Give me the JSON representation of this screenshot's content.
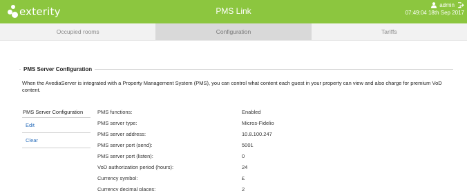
{
  "header": {
    "logo_text": "exterity",
    "app_title": "PMS Link",
    "user_name": "admin",
    "datetime": "07:49:04 18th Sep 2017",
    "icons": {
      "user": "user-icon",
      "logout": "logout-icon"
    }
  },
  "tabs": [
    {
      "label": "Occupied rooms",
      "active": false
    },
    {
      "label": "Configuration",
      "active": true
    },
    {
      "label": "Tariffs",
      "active": false
    }
  ],
  "section": {
    "title": "PMS Server Configuration",
    "intro": "When the AvediaServer is integrated with a Property Management System (PMS), you can control what content each guest in your property can view and also charge for premium VoD content."
  },
  "sidebar": {
    "title": "PMS Server Configuration",
    "items": [
      {
        "label": "Edit"
      },
      {
        "label": "Clear"
      }
    ]
  },
  "settings": [
    {
      "label": "PMS functions:",
      "value": "Enabled"
    },
    {
      "label": "PMS server type:",
      "value": "Micros-Fidelio"
    },
    {
      "label": "PMS server address:",
      "value": "10.8.100.247"
    },
    {
      "label": "PMS server port (send):",
      "value": "5001"
    },
    {
      "label": "PMS server port (listen):",
      "value": "0"
    },
    {
      "label": "VoD authorization period (hours):",
      "value": "24"
    },
    {
      "label": "Currency symbol:",
      "value": "£"
    },
    {
      "label": "Currency decimal places:",
      "value": "2"
    }
  ],
  "colors": {
    "brand": "#8cc63f",
    "link": "#2a6ebb",
    "active_tab": "#d9d9d9"
  }
}
